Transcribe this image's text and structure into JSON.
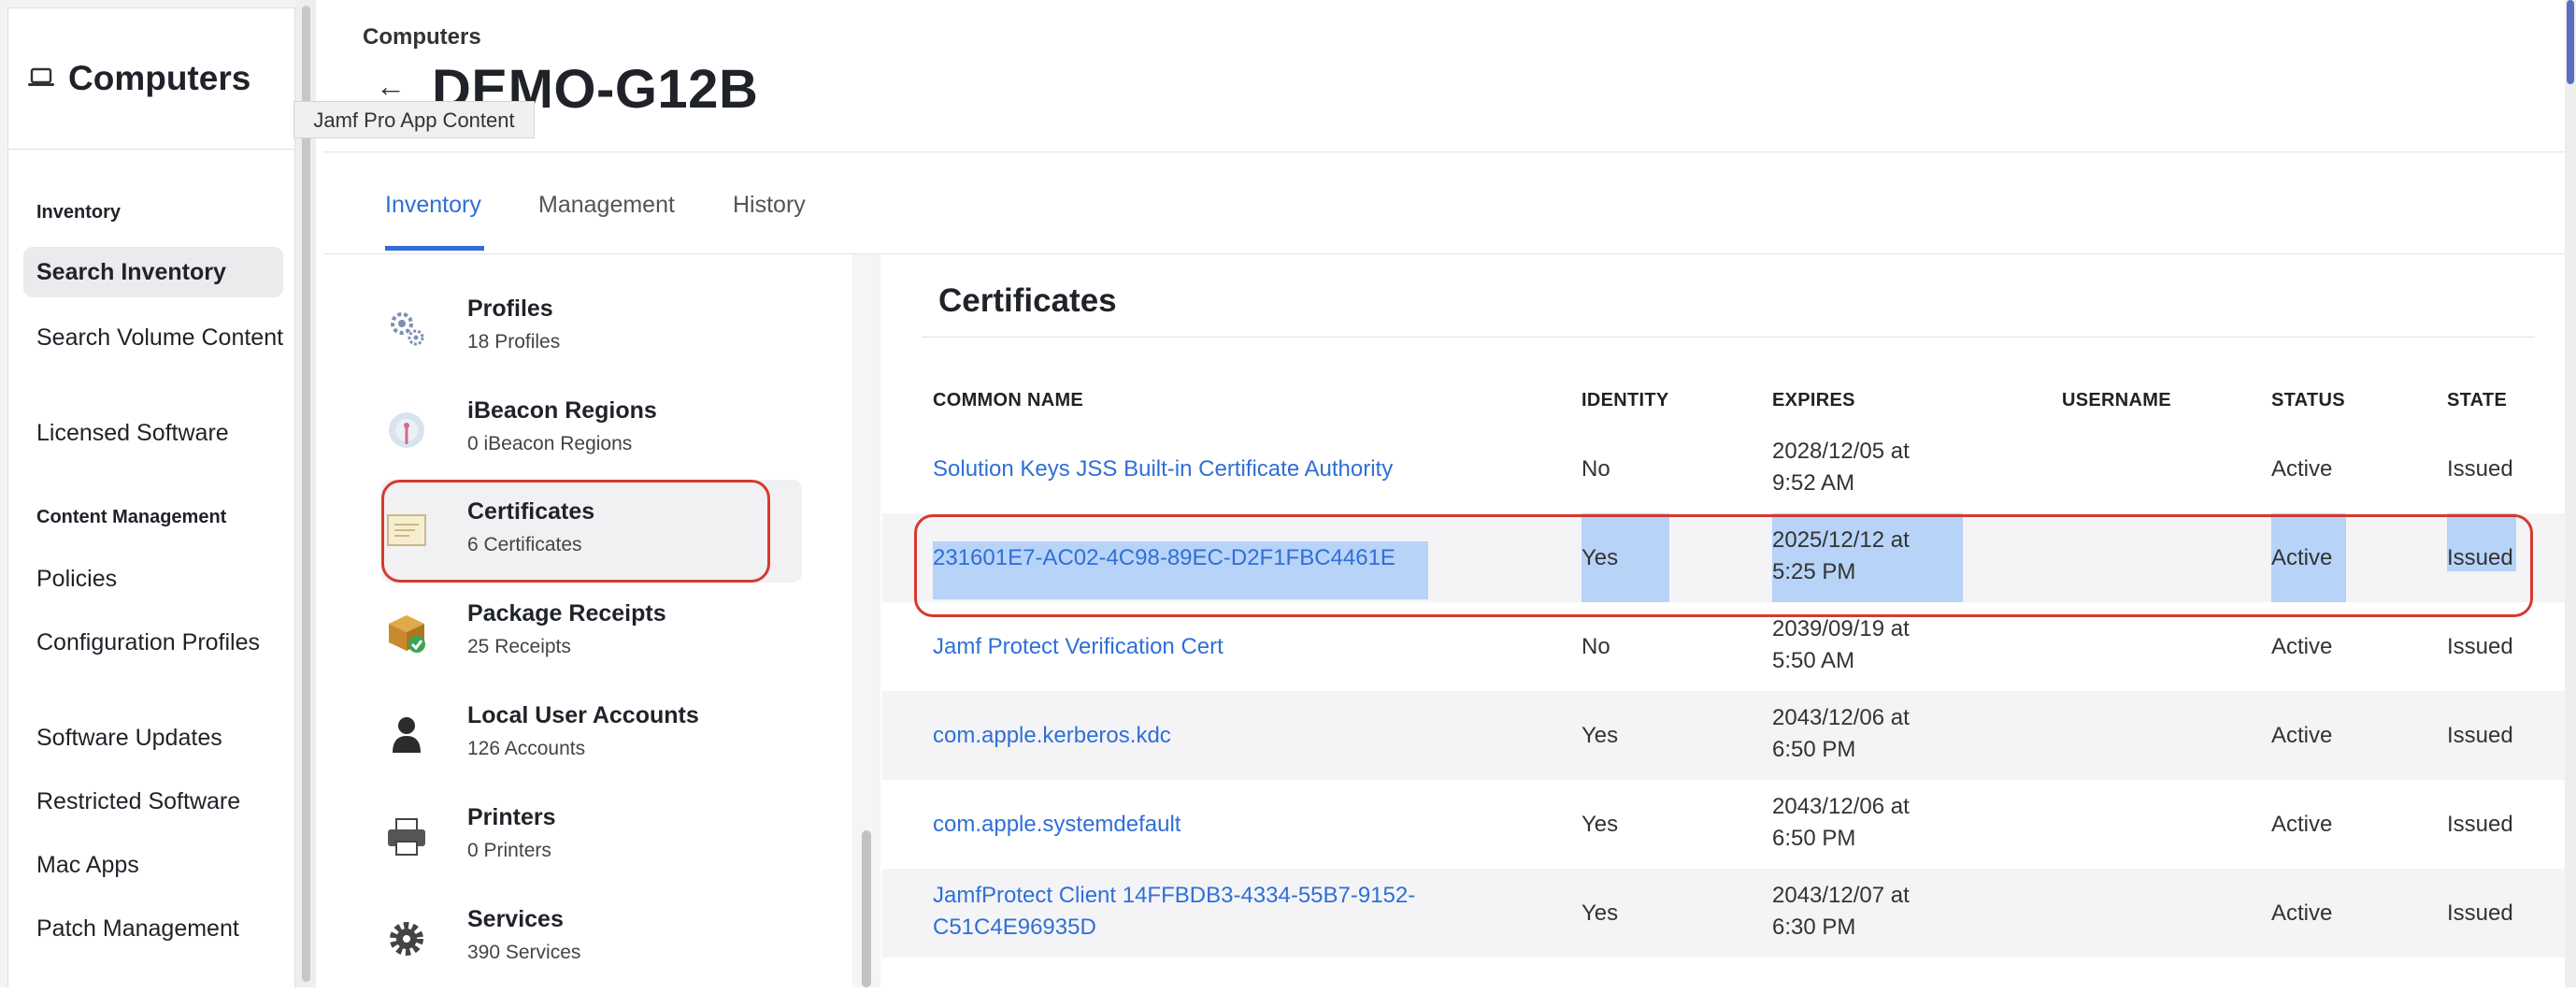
{
  "sidebar": {
    "title": "Computers",
    "icon": "laptop-icon",
    "sections": [
      {
        "heading": "Inventory",
        "items": [
          "Search Inventory",
          "Search Volume Content",
          "Licensed Software"
        ]
      },
      {
        "heading": "Content Management",
        "items": [
          "Policies",
          "Configuration Profiles",
          "Software Updates",
          "Restricted Software",
          "Mac Apps",
          "Patch Management"
        ]
      }
    ],
    "active_item": "Search Inventory"
  },
  "header": {
    "breadcrumb": "Computers",
    "back_icon": "back-arrow-icon",
    "back_glyph": "←",
    "title": "DEMO-G12B",
    "tooltip": "Jamf Pro App Content"
  },
  "tabs": [
    {
      "label": "Inventory",
      "active": true
    },
    {
      "label": "Management",
      "active": false
    },
    {
      "label": "History",
      "active": false
    }
  ],
  "categories": [
    {
      "name": "Profiles",
      "count": "18 Profiles",
      "icon": "gears-icon"
    },
    {
      "name": "iBeacon Regions",
      "count": "0 iBeacon Regions",
      "icon": "ibeacon-icon"
    },
    {
      "name": "Certificates",
      "count": "6 Certificates",
      "icon": "certificate-icon",
      "selected": true
    },
    {
      "name": "Package Receipts",
      "count": "25 Receipts",
      "icon": "package-icon"
    },
    {
      "name": "Local User Accounts",
      "count": "126 Accounts",
      "icon": "user-icon"
    },
    {
      "name": "Printers",
      "count": "0 Printers",
      "icon": "printer-icon"
    },
    {
      "name": "Services",
      "count": "390 Services",
      "icon": "gear-icon"
    }
  ],
  "certificates": {
    "title": "Certificates",
    "columns": [
      "COMMON NAME",
      "IDENTITY",
      "EXPIRES",
      "USERNAME",
      "STATUS",
      "STATE"
    ],
    "rows": [
      {
        "common_name": "Solution Keys JSS Built-in Certificate Authority",
        "common_name_2": "",
        "identity": "No",
        "expires_1": "2028/12/05 at",
        "expires_2": "9:52 AM",
        "username": "",
        "status": "Active",
        "state": "Issued"
      },
      {
        "common_name": "231601E7-AC02-4C98-89EC-D2F1FBC4461E",
        "common_name_2": "",
        "identity": "Yes",
        "expires_1": "2025/12/12 at",
        "expires_2": "5:25 PM",
        "username": "",
        "status": "Active",
        "state": "Issued",
        "selected": true
      },
      {
        "common_name": "Jamf Protect Verification Cert",
        "common_name_2": "",
        "identity": "No",
        "expires_1": "2039/09/19 at",
        "expires_2": "5:50 AM",
        "username": "",
        "status": "Active",
        "state": "Issued"
      },
      {
        "common_name": "com.apple.kerberos.kdc",
        "common_name_2": "",
        "identity": "Yes",
        "expires_1": "2043/12/06 at",
        "expires_2": "6:50 PM",
        "username": "",
        "status": "Active",
        "state": "Issued"
      },
      {
        "common_name": "com.apple.systemdefault",
        "common_name_2": "",
        "identity": "Yes",
        "expires_1": "2043/12/06 at",
        "expires_2": "6:50 PM",
        "username": "",
        "status": "Active",
        "state": "Issued"
      },
      {
        "common_name": "JamfProtect Client 14FFBDB3-4334-55B7-9152-",
        "common_name_2": "C51C4E96935D",
        "identity": "Yes",
        "expires_1": "2043/12/07 at",
        "expires_2": "6:30 PM",
        "username": "",
        "status": "Active",
        "state": "Issued"
      }
    ]
  },
  "colors": {
    "accent": "#2f6fd6",
    "highlight_border": "#d63a2f",
    "selection": "#b7d3f7"
  }
}
